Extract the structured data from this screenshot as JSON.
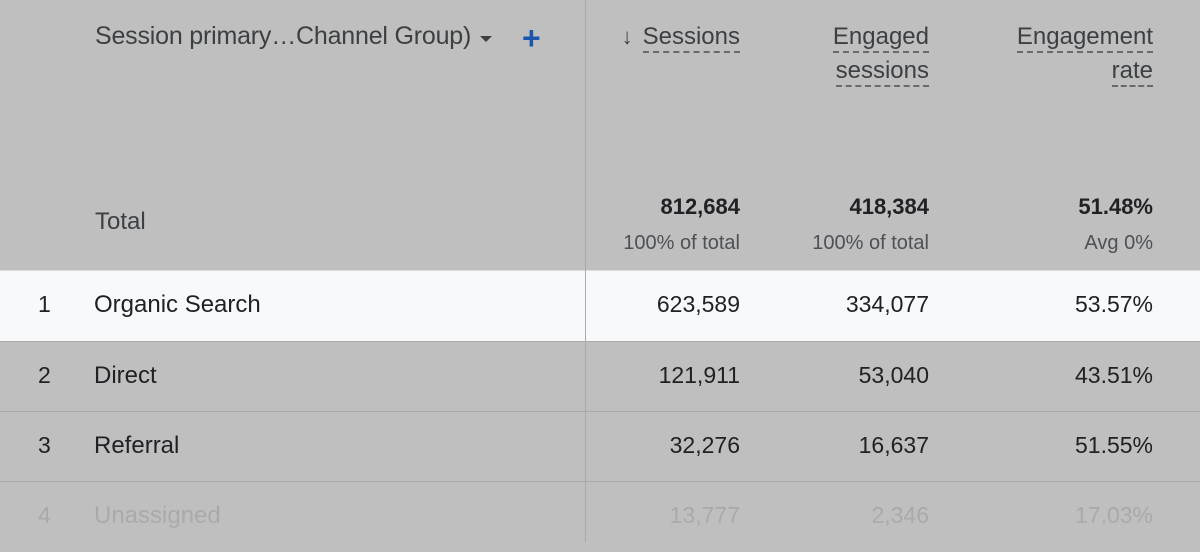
{
  "header": {
    "dimension_label": "Session primary…Channel Group)",
    "dropdown_icon": "caret-down-icon",
    "add_icon": "plus-icon",
    "columns": [
      {
        "line1": "Sessions",
        "line2": "",
        "sorted": "descending",
        "sort_icon": "arrow-down-icon"
      },
      {
        "line1": "Engaged",
        "line2": "sessions"
      },
      {
        "line1": "Engagement",
        "line2": "rate"
      }
    ]
  },
  "totals": {
    "label": "Total",
    "sessions": {
      "value": "812,684",
      "sub": "100% of total"
    },
    "engaged_sessions": {
      "value": "418,384",
      "sub": "100% of total"
    },
    "engagement_rate": {
      "value": "51.48%",
      "sub": "Avg 0%"
    }
  },
  "rows": [
    {
      "index": "1",
      "channel": "Organic Search",
      "sessions": "623,589",
      "engaged_sessions": "334,077",
      "engagement_rate": "53.57%"
    },
    {
      "index": "2",
      "channel": "Direct",
      "sessions": "121,911",
      "engaged_sessions": "53,040",
      "engagement_rate": "43.51%"
    },
    {
      "index": "3",
      "channel": "Referral",
      "sessions": "32,276",
      "engaged_sessions": "16,637",
      "engagement_rate": "51.55%"
    },
    {
      "index": "4",
      "channel": "Unassigned",
      "sessions": "13,777",
      "engaged_sessions": "2,346",
      "engagement_rate": "17.03%"
    }
  ],
  "colors": {
    "overlay": "#bfbfbf",
    "highlight_row": "#f8f9fa",
    "accent": "#1a56b0"
  }
}
